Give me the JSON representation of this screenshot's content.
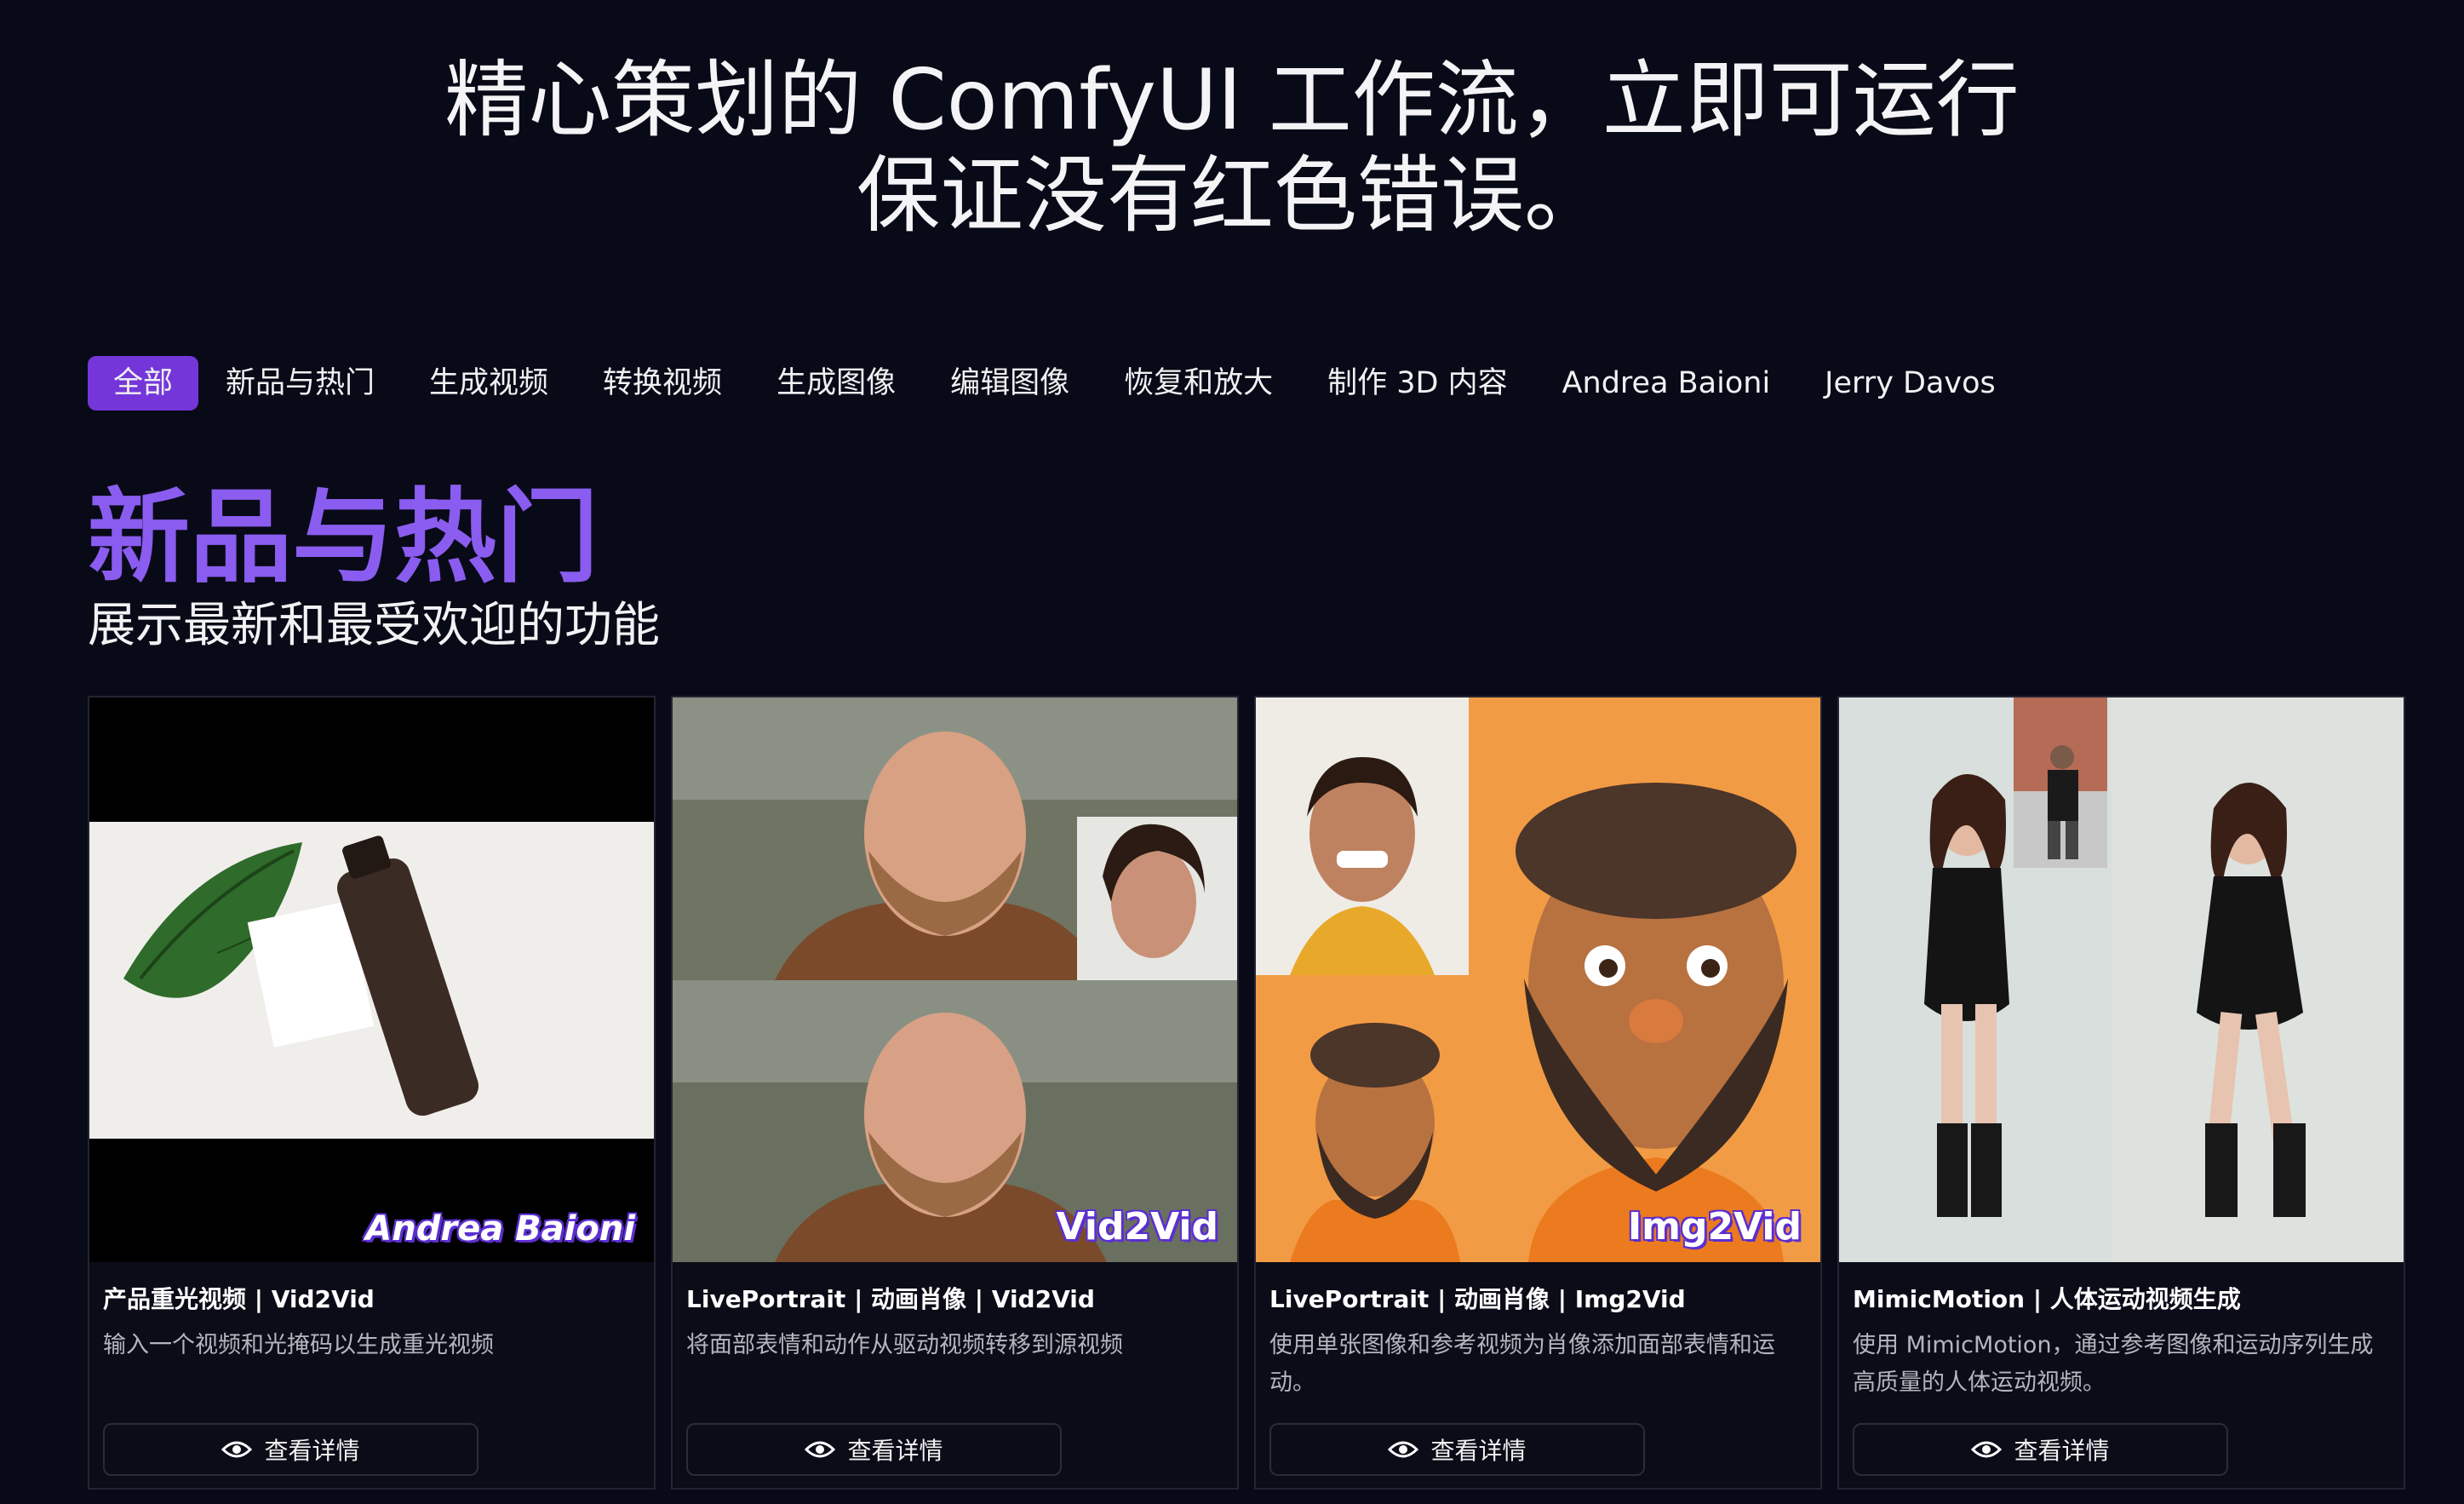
{
  "hero": {
    "line1": "精心策划的 ComfyUI 工作流，立即可运行",
    "line2": "保证没有红色错误。"
  },
  "tabs": [
    {
      "label": "全部",
      "active": true
    },
    {
      "label": "新品与热门",
      "active": false
    },
    {
      "label": "生成视频",
      "active": false
    },
    {
      "label": "转换视频",
      "active": false
    },
    {
      "label": "生成图像",
      "active": false
    },
    {
      "label": "编辑图像",
      "active": false
    },
    {
      "label": "恢复和放大",
      "active": false
    },
    {
      "label": "制作 3D 内容",
      "active": false
    },
    {
      "label": "Andrea Baioni",
      "active": false
    },
    {
      "label": "Jerry Davos",
      "active": false
    }
  ],
  "section": {
    "title": "新品与热门",
    "subtitle": "展示最新和最受欢迎的功能"
  },
  "cards": [
    {
      "title": "产品重光视频 | Vid2Vid",
      "description": "输入一个视频和光掩码以生成重光视频",
      "overlay": "Andrea Baioni",
      "button": "查看详情"
    },
    {
      "title": "LivePortrait | 动画肖像 | Vid2Vid",
      "description": "将面部表情和动作从驱动视频转移到源视频",
      "overlay": "Vid2Vid",
      "button": "查看详情"
    },
    {
      "title": "LivePortrait | 动画肖像 | Img2Vid",
      "description": "使用单张图像和参考视频为肖像添加面部表情和运动。",
      "overlay": "Img2Vid",
      "button": "查看详情"
    },
    {
      "title": "MimicMotion | 人体运动视频生成",
      "description": "使用 MimicMotion，通过参考图像和运动序列生成高质量的人体运动视频。",
      "overlay": "",
      "button": "查看详情"
    }
  ],
  "colors": {
    "background": "#090a17",
    "accent": "#7436d9",
    "section_title": "#8a5cf0"
  }
}
